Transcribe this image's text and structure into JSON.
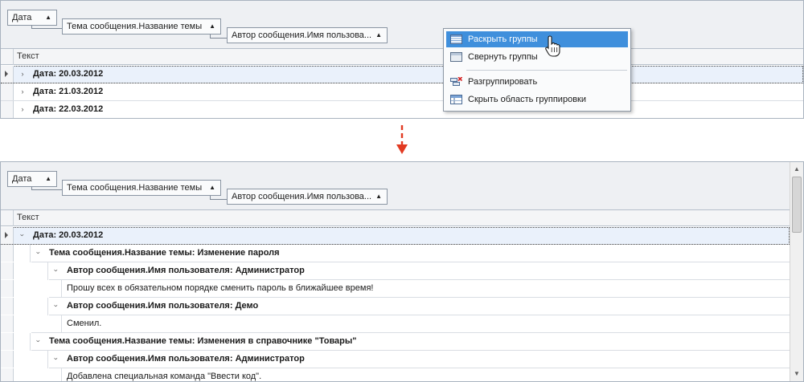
{
  "group_panel": {
    "chips": [
      {
        "label": "Дата",
        "sort": "▲"
      },
      {
        "label": "Тема сообщения.Название темы",
        "sort": "▲"
      },
      {
        "label": "Автор сообщения.Имя пользова...",
        "sort": "▲"
      }
    ]
  },
  "column_header": "Текст",
  "top": {
    "rows": [
      {
        "label": "Дата: 20.03.2012"
      },
      {
        "label": "Дата: 21.03.2012"
      },
      {
        "label": "Дата: 22.03.2012"
      }
    ],
    "context_menu": {
      "items": [
        {
          "label": "Раскрыть группы"
        },
        {
          "label": "Свернуть группы"
        },
        {
          "label": "Разгруппировать"
        },
        {
          "label": "Скрыть область группировки"
        }
      ]
    }
  },
  "bottom": {
    "rows": [
      {
        "label": "Дата: 20.03.2012"
      },
      {
        "label": "Тема сообщения.Название темы: Изменение пароля"
      },
      {
        "label": "Автор сообщения.Имя пользователя: Администратор"
      },
      {
        "label": "Прошу всех в обязательном порядке сменить пароль в ближайшее время!"
      },
      {
        "label": "Автор сообщения.Имя пользователя: Демо"
      },
      {
        "label": "Сменил."
      },
      {
        "label": "Тема сообщения.Название темы: Изменения в справочнике \"Товары\""
      },
      {
        "label": "Автор сообщения.Имя пользователя: Администратор"
      },
      {
        "label": "Добавлена специальная команда \"Ввести код\"."
      }
    ]
  },
  "colors": {
    "accent": "#3f8fdc",
    "arrow": "#e23a22",
    "border": "#a9b3bf"
  }
}
